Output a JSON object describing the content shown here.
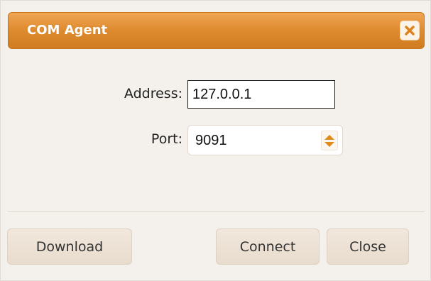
{
  "dialog": {
    "title": "COM Agent",
    "close_icon": "close-x-icon",
    "accent_color": "#de8a2e"
  },
  "form": {
    "address_label": "Address:",
    "address_value": "127.0.0.1",
    "port_label": "Port:",
    "port_value": "9091",
    "spinner_icon": "up-down-arrows-icon"
  },
  "buttons": {
    "download": "Download",
    "connect": "Connect",
    "close": "Close"
  }
}
